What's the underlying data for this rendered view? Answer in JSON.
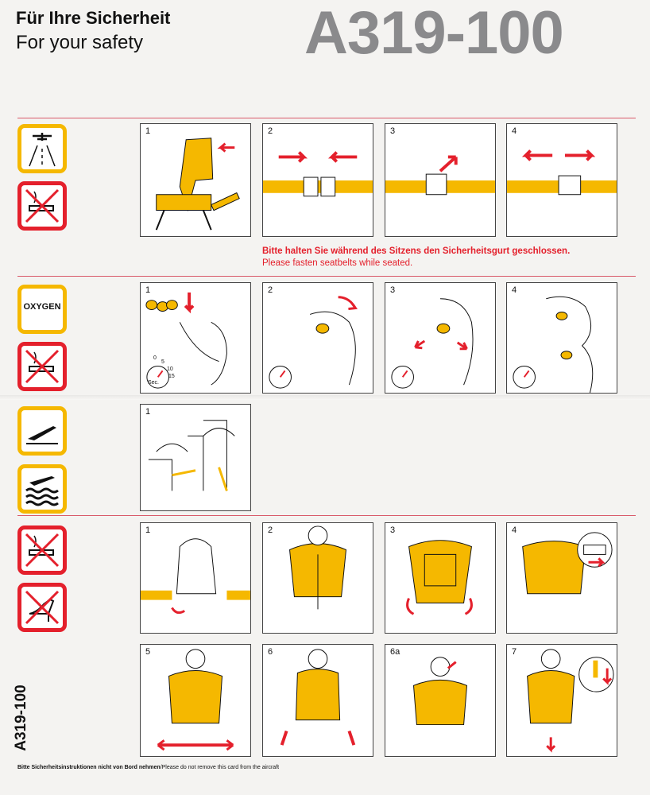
{
  "header": {
    "title_de": "Für Ihre Sicherheit",
    "title_en": "For your safety",
    "model": "A319-100"
  },
  "seatbelt_notice": {
    "de": "Bitte halten Sie während des Sitzens den Sicherheitsgurt geschlossen.",
    "en": "Please fasten seatbelts while seated."
  },
  "icons": {
    "oxygen_label": "OXYGEN"
  },
  "seatbelt_steps": [
    "1",
    "2",
    "3",
    "4"
  ],
  "oxygen_steps": [
    "1",
    "2",
    "3",
    "4"
  ],
  "oxygen_timer": {
    "ticks": [
      "0",
      "5",
      "10",
      "15"
    ],
    "unit": "Sec."
  },
  "brace_steps": [
    "1"
  ],
  "lifevest_steps": [
    "1",
    "2",
    "3",
    "4",
    "5",
    "6",
    "6a",
    "7"
  ],
  "footer": {
    "de": "Bitte Sicherheitsinstruktionen nicht von Bord nehmen",
    "en": "/Please do not remove this card from the aircraft"
  },
  "side_label": "A319-100",
  "colors": {
    "accent_yellow": "#f5b800",
    "accent_red": "#e4202c",
    "model_grey": "#8a8a8c"
  }
}
